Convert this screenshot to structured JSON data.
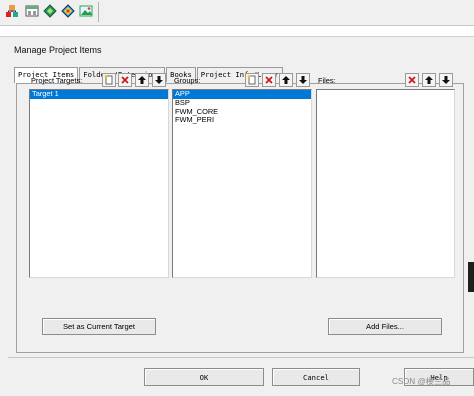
{
  "toolbar": {
    "icons": [
      "project-tree-icon",
      "window-layout-icon",
      "diamond-green-icon",
      "diamond-multi-icon",
      "load-image-icon"
    ]
  },
  "dialog": {
    "title": "Manage Project Items",
    "tabs": [
      {
        "label": "Project Items"
      },
      {
        "label": "Folders/Extensions"
      },
      {
        "label": "Books"
      },
      {
        "label": "Project Info/Layer"
      }
    ],
    "project_targets": {
      "label": "Project Targets:",
      "items": [
        {
          "label": "Target 1"
        }
      ]
    },
    "groups": {
      "label": "Groups:",
      "items": [
        {
          "label": "APP"
        },
        {
          "label": "BSP"
        },
        {
          "label": "FWM_CORE"
        },
        {
          "label": "FWM_PERI"
        }
      ]
    },
    "files": {
      "label": "Files:",
      "items": []
    },
    "buttons": {
      "set_current": "Set as Current Target",
      "add_files": "Add Files...",
      "ok": "OK",
      "cancel": "Cancel",
      "help": "Help"
    }
  },
  "watermark": "CSDN @楼兰品"
}
